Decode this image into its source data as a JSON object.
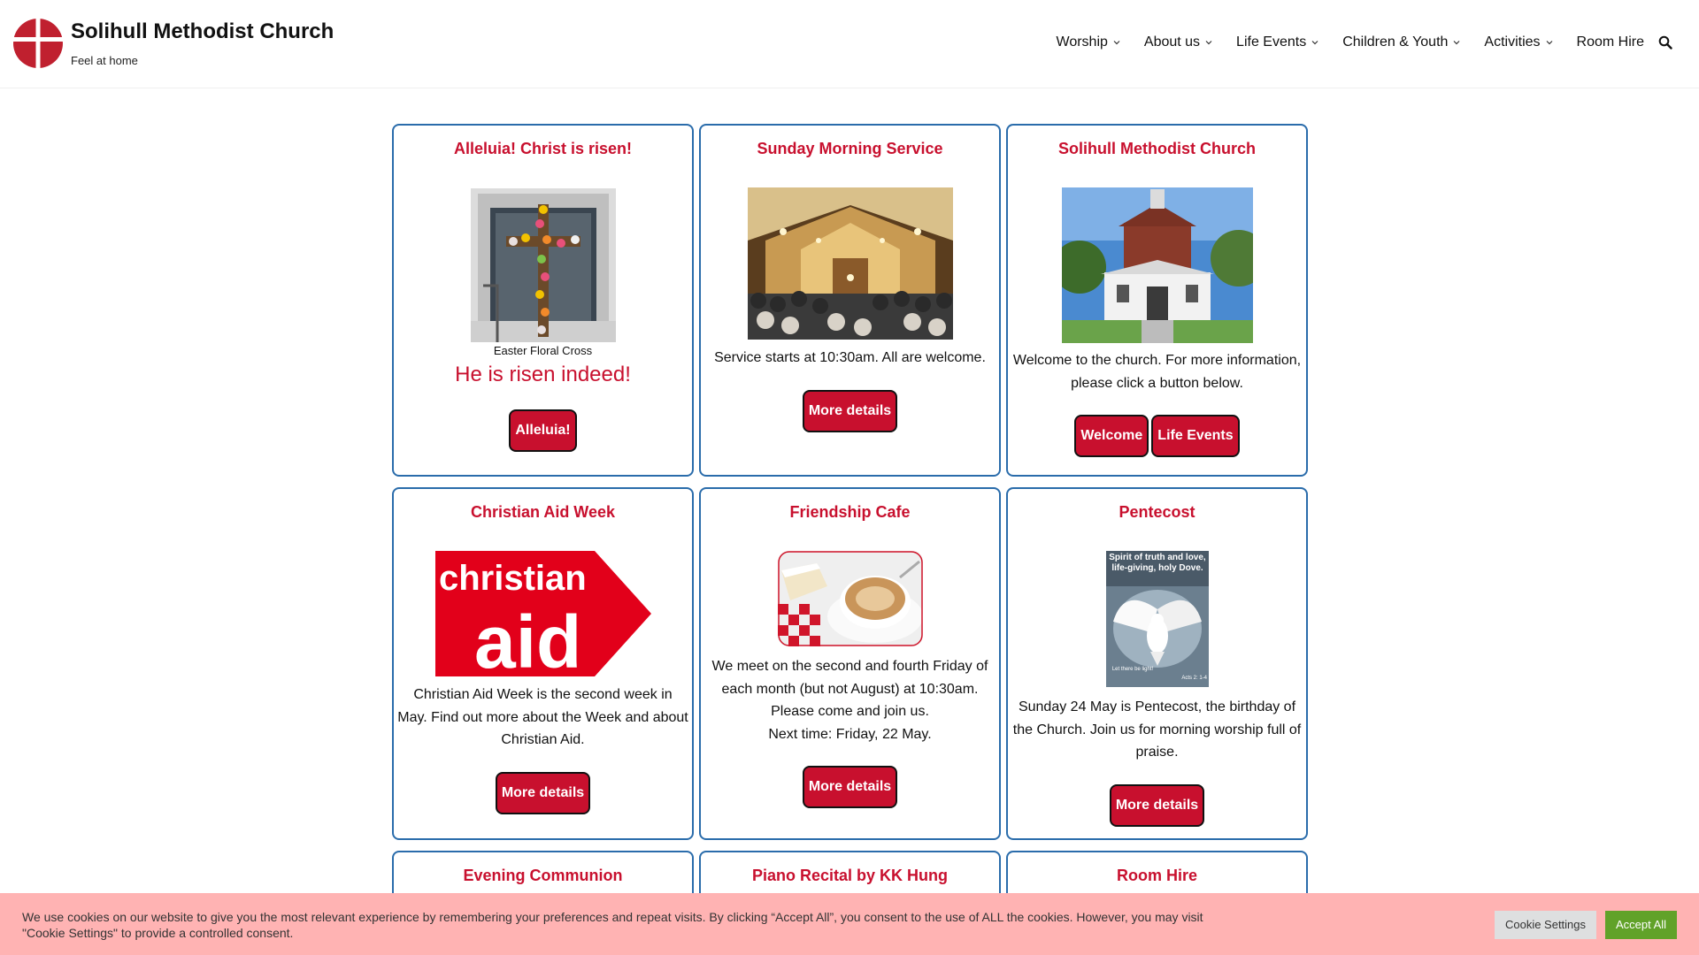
{
  "header": {
    "title": "Solihull Methodist Church",
    "tagline": "Feel at home",
    "nav": [
      {
        "label": "Worship",
        "dropdown": true
      },
      {
        "label": "About us",
        "dropdown": true
      },
      {
        "label": "Life Events",
        "dropdown": true
      },
      {
        "label": "Children & Youth",
        "dropdown": true
      },
      {
        "label": "Activities",
        "dropdown": true
      },
      {
        "label": "Room Hire",
        "dropdown": false
      }
    ],
    "search_icon": "search-icon"
  },
  "cards": {
    "alleluia": {
      "title": "Alleluia! Christ is risen!",
      "caption": "Easter Floral Cross",
      "tagline": "He is risen indeed!",
      "button": "Alleluia!"
    },
    "sunday": {
      "title": "Sunday Morning Service",
      "text": "Service starts at 10:30am. All are welcome.",
      "button": "More details"
    },
    "church": {
      "title": "Solihull Methodist Church",
      "text": "Welcome to the church. For more information, please click a button below.",
      "buttons": [
        "Welcome",
        "Life Events"
      ]
    },
    "christian_aid": {
      "title": "Christian Aid Week",
      "logo_text_top": "christian",
      "logo_text_bottom": "aid",
      "text": "Christian Aid Week is the second week in May. Find out more about the Week and about Christian Aid.",
      "button": "More details"
    },
    "cafe": {
      "title": "Friendship Cafe",
      "text": "We meet on the second and fourth Friday of each month (but not August) at 10:30am. Please come and join us.",
      "next": "Next time: Friday, 22 May.",
      "button": "More details"
    },
    "pentecost": {
      "title": "Pentecost",
      "poster_text": "Spirit of truth and love, life-giving, holy Dove.",
      "poster_small_left": "Let there be light!",
      "poster_small_right": "Acts 2: 1-4",
      "text": "Sunday 24 May is Pentecost, the birthday of the Church. Join us for morning worship full of praise.",
      "button": "More details"
    },
    "communion": {
      "title": "Evening Communion"
    },
    "recital": {
      "title": "Piano Recital by KK Hung"
    },
    "roomhire": {
      "title": "Room Hire"
    }
  },
  "cookie": {
    "text": "We use cookies on our website to give you the most relevant experience by remembering your preferences and repeat visits. By clicking “Accept All”, you consent to the use of ALL the cookies. However, you may visit \"Cookie Settings\" to provide a controlled consent.",
    "settings_label": "Cookie Settings",
    "accept_label": "Accept All"
  },
  "colors": {
    "accent_red": "#c8102e",
    "card_border": "#2a6cab",
    "cookie_bg": "#ffb3b3",
    "accept_green": "#61a229"
  }
}
